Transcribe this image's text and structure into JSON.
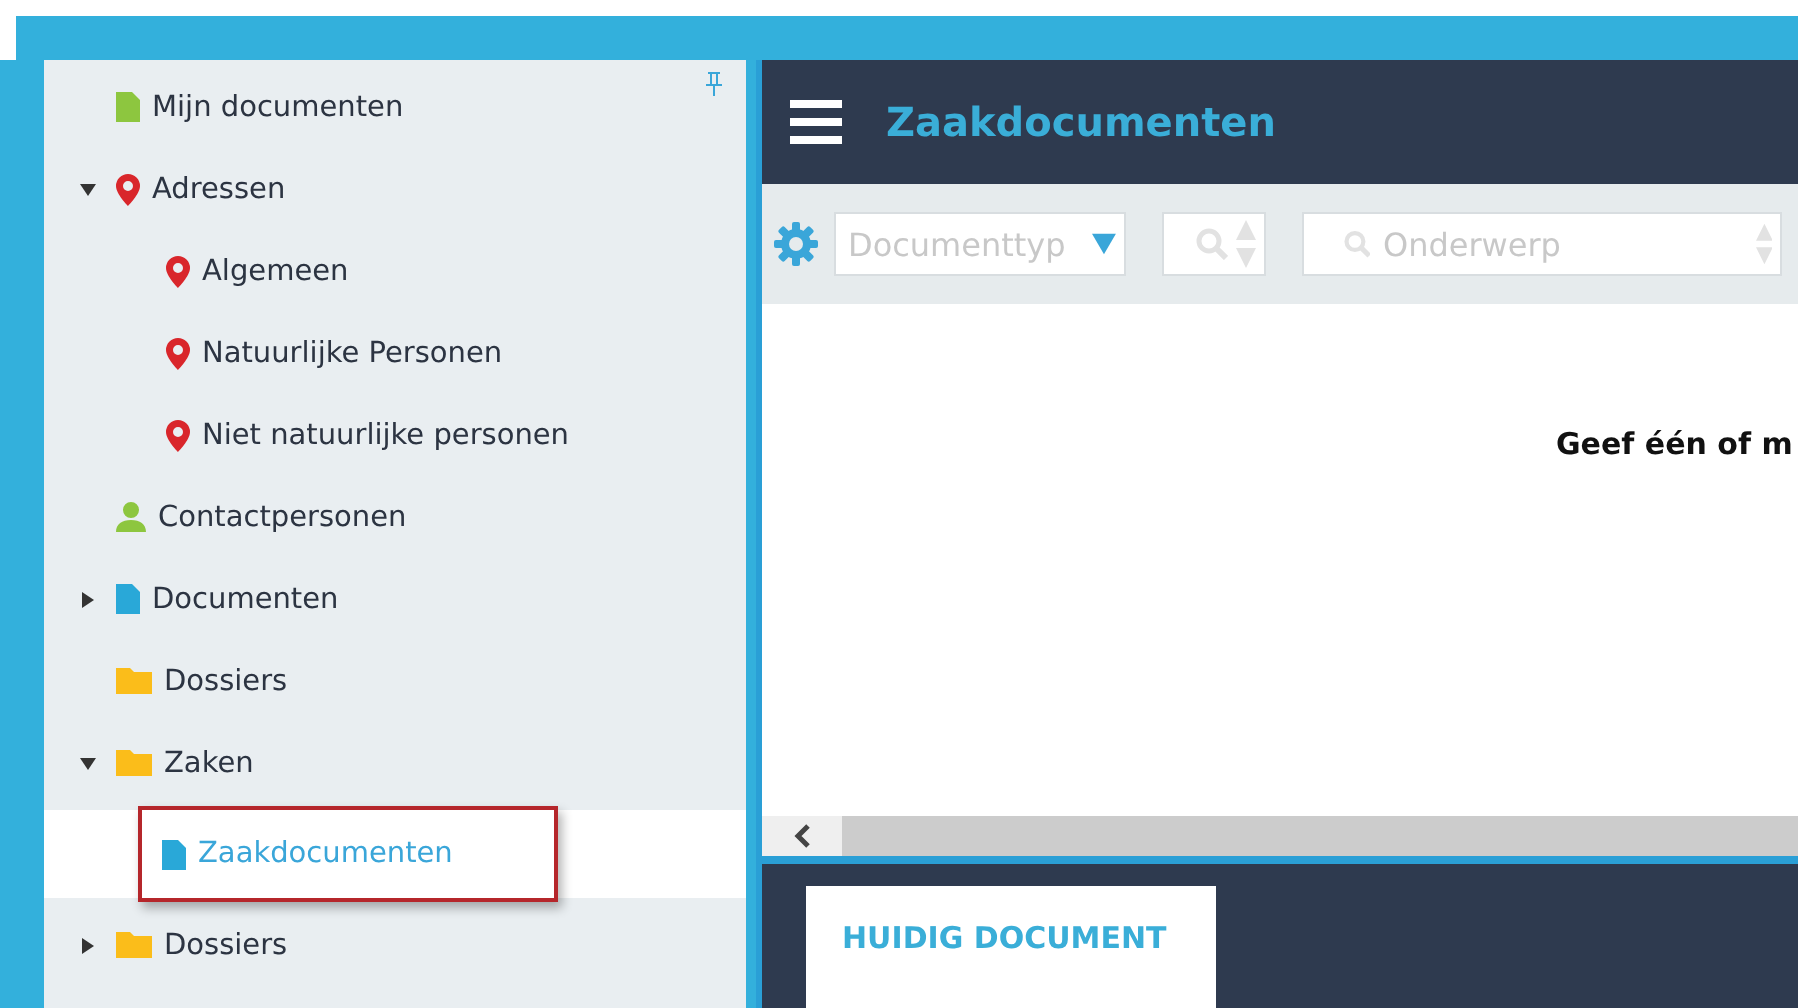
{
  "sidebar": {
    "items": [
      {
        "label": "Mijn documenten",
        "kind": "document",
        "color": "#8dc63f",
        "selected": false
      },
      {
        "label": "Adressen",
        "kind": "pin",
        "color": "#d9262b",
        "selected": false,
        "expanded": true,
        "children": [
          {
            "label": "Algemeen",
            "kind": "pin",
            "color": "#d9262b",
            "selected": false
          },
          {
            "label": "Natuurlijke Personen",
            "kind": "pin",
            "color": "#d9262b",
            "selected": false
          },
          {
            "label": "Niet natuurlijke personen",
            "kind": "pin",
            "color": "#d9262b",
            "selected": false
          }
        ]
      },
      {
        "label": "Contactpersonen",
        "kind": "person",
        "color": "#8dc63f",
        "selected": false
      },
      {
        "label": "Documenten",
        "kind": "document",
        "color": "#29a8d8",
        "selected": false,
        "expanded": false
      },
      {
        "label": "Dossiers",
        "kind": "folder",
        "color": "#fbbd1a",
        "selected": false
      },
      {
        "label": "Zaken",
        "kind": "folder",
        "color": "#fbbd1a",
        "selected": false,
        "expanded": true,
        "children": [
          {
            "label": "Zaakdocumenten",
            "kind": "document",
            "color": "#29a8d8",
            "selected": true
          }
        ]
      },
      {
        "label": "Dossiers",
        "kind": "folder",
        "color": "#fbbd1a",
        "selected": false,
        "expanded": false
      }
    ]
  },
  "header": {
    "title": "Zaakdocumenten"
  },
  "toolbar": {
    "document_type": {
      "placeholder": "Documenttyp"
    },
    "subject_search": {
      "placeholder": "Onderwerp"
    }
  },
  "content": {
    "message": "Geef één of m"
  },
  "bottom_tabs": [
    {
      "label": "HUIDIG DOCUMENT",
      "selected": true
    }
  ]
}
